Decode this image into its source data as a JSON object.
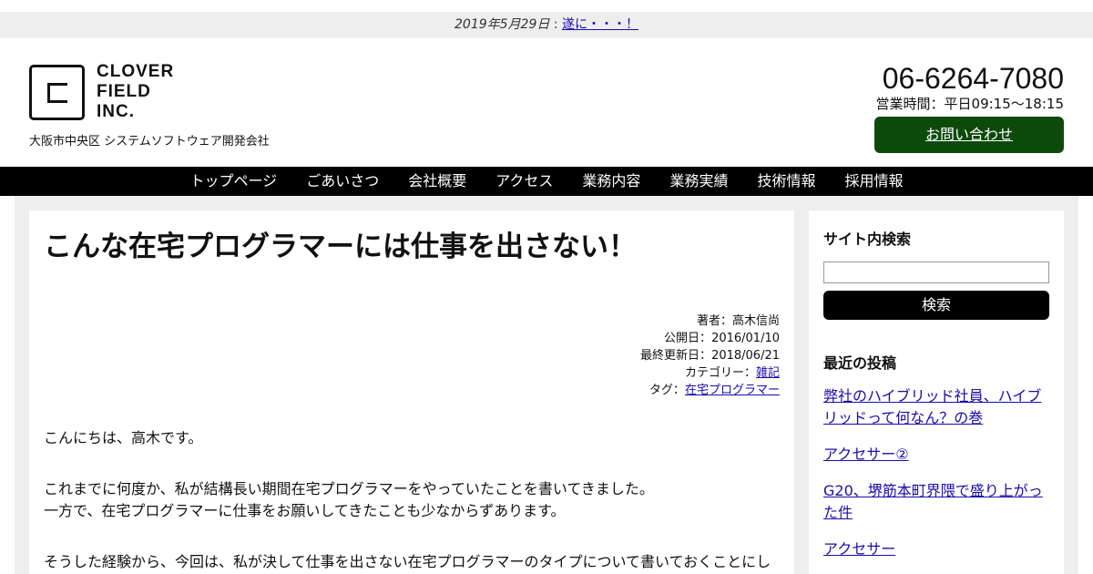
{
  "notice": {
    "date": "2019年5月29日",
    "separator": " : ",
    "link": "遂に・・・！"
  },
  "header": {
    "logo_lines": [
      "CLOVER",
      "FIELD",
      "INC."
    ],
    "tagline": "大阪市中央区 システムソフトウェア開発会社",
    "phone": "06-6264-7080",
    "hours": "営業時間：平日09:15〜18:15",
    "inquiry_label": "お問い合わせ"
  },
  "nav": {
    "items": [
      "トップページ",
      "ごあいさつ",
      "会社概要",
      "アクセス",
      "業務内容",
      "業務実績",
      "技術情報",
      "採用情報"
    ]
  },
  "article": {
    "title": "こんな在宅プログラマーには仕事を出さない！",
    "author_label": "著者：",
    "author": "高木信尚",
    "published_label": "公開日：",
    "published": "2016/01/10",
    "updated_label": "最終更新日：",
    "updated": "2018/06/21",
    "category_label": "カテゴリー：",
    "category": "雑記",
    "tag_label": "タグ：",
    "tag": "在宅プログラマー",
    "paragraphs": [
      [
        "こんにちは、高木です。"
      ],
      [
        "これまでに何度か、私が結構長い期間在宅プログラマーをやっていたことを書いてきました。",
        "一方で、在宅プログラマーに仕事をお願いしてきたことも少なからずあります。"
      ],
      [
        "そうした経験から、今回は、私が決して仕事を出さない在宅プログラマーのタイプについて書いておくことにし"
      ]
    ]
  },
  "sidebar": {
    "search_heading": "サイト内検索",
    "search_value": "",
    "search_button": "検索",
    "recent_heading": "最近の投稿",
    "recent_posts": [
      "弊社のハイブリッド社員、ハイブリッドって何なん？の巻",
      "アクセサー②",
      "G20、堺筋本町界隈で盛り上がった件",
      "アクセサー"
    ]
  },
  "colors": {
    "accent_green": "#0c4a0c",
    "nav_bg": "#000000",
    "link": "#1a0dab",
    "page_bg": "#eeeeee"
  }
}
